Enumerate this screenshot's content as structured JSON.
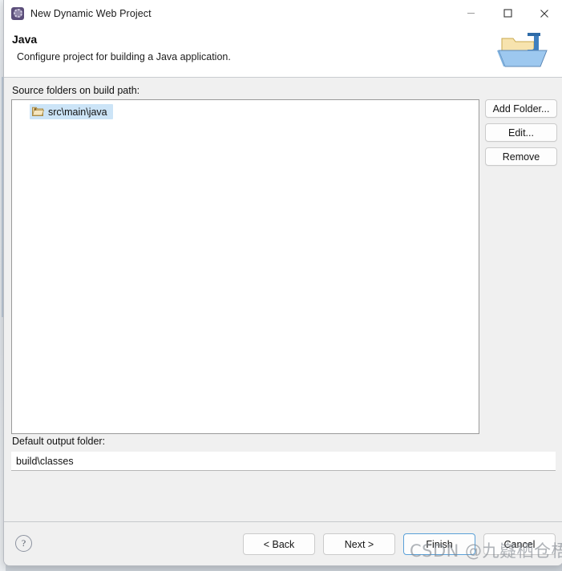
{
  "window": {
    "title": "New Dynamic Web Project",
    "app_icon": "eclipse-wizard-icon",
    "controls": {
      "minimize": "minimize-icon",
      "maximize": "maximize-icon",
      "close": "close-icon"
    }
  },
  "header": {
    "title": "Java",
    "subtitle": "Configure project for building a Java application.",
    "graphic": "java-project-folder-icon"
  },
  "body": {
    "source_label": "Source folders on build path:",
    "tree_items": [
      {
        "label": "src\\main\\java",
        "icon": "source-folder-icon",
        "selected": true
      }
    ],
    "side_buttons": [
      {
        "label": "Add Folder...",
        "name": "add-folder-button"
      },
      {
        "label": "Edit...",
        "name": "edit-button"
      },
      {
        "label": "Remove",
        "name": "remove-button"
      }
    ],
    "output_label": "Default output folder:",
    "output_value": "build\\classes",
    "output_placeholder": "Default output folder"
  },
  "footer": {
    "help": "?",
    "buttons": [
      {
        "label": "< Back",
        "name": "back-button",
        "default": false
      },
      {
        "label": "Next >",
        "name": "next-button",
        "default": false
      },
      {
        "label": "Finish",
        "name": "finish-button",
        "default": true
      },
      {
        "label": "Cancel",
        "name": "cancel-button",
        "default": false
      }
    ]
  },
  "watermark": {
    "text": "CSDN @九嶷栖仓梧"
  },
  "colors": {
    "accent": "#5aa0d8",
    "selection": "#cce4f7",
    "dialog_bg": "#f0f0f0",
    "header_bg": "#ffffff"
  }
}
